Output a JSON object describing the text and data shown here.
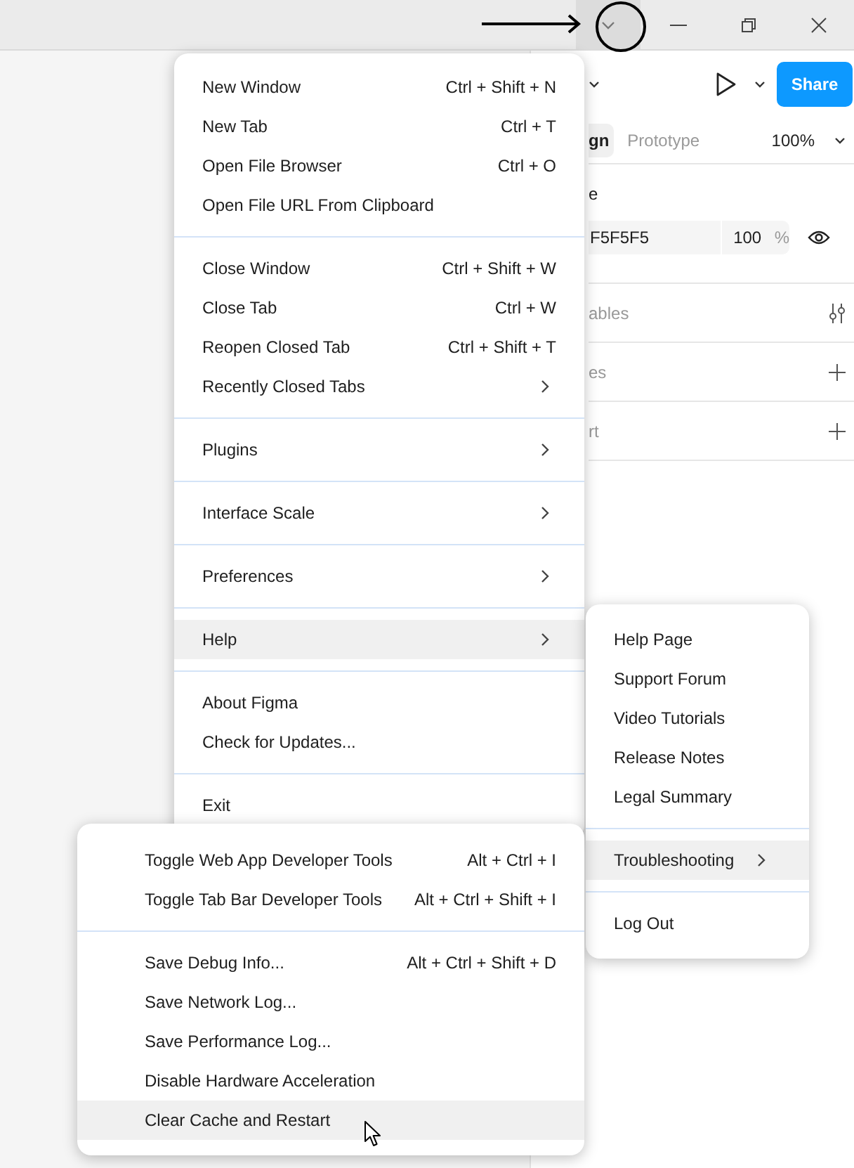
{
  "toolbar": {
    "share": "Share"
  },
  "panel": {
    "tabs": [
      {
        "label": "gn",
        "selected": true
      },
      {
        "label": "Prototype",
        "selected": false
      }
    ],
    "zoom": "100%",
    "section_label": "e",
    "fill": {
      "hex": "F5F5F5",
      "opacity": "100",
      "unit": "%"
    },
    "sections": [
      {
        "label": "ables",
        "kind": "settings"
      },
      {
        "label": "es",
        "kind": "add"
      },
      {
        "label": "rt",
        "kind": "add"
      }
    ]
  },
  "main_menu": {
    "groups": [
      {
        "items": [
          {
            "label": "New Window",
            "shortcut": "Ctrl + Shift + N",
            "submenu": false,
            "selected": false
          },
          {
            "label": "New Tab",
            "shortcut": "Ctrl + T",
            "submenu": false,
            "selected": false
          },
          {
            "label": "Open File Browser",
            "shortcut": "Ctrl + O",
            "submenu": false,
            "selected": false
          },
          {
            "label": "Open File URL From Clipboard",
            "submenu": false,
            "selected": false
          }
        ]
      },
      {
        "items": [
          {
            "label": "Close Window",
            "shortcut": "Ctrl + Shift + W",
            "submenu": false,
            "selected": false
          },
          {
            "label": "Close Tab",
            "shortcut": "Ctrl + W",
            "submenu": false,
            "selected": false
          },
          {
            "label": "Reopen Closed Tab",
            "shortcut": "Ctrl + Shift + T",
            "submenu": false,
            "selected": false
          },
          {
            "label": "Recently Closed Tabs",
            "submenu": true,
            "selected": false
          }
        ]
      },
      {
        "items": [
          {
            "label": "Plugins",
            "submenu": true,
            "selected": false
          }
        ]
      },
      {
        "items": [
          {
            "label": "Interface Scale",
            "submenu": true,
            "selected": false
          }
        ]
      },
      {
        "items": [
          {
            "label": "Preferences",
            "submenu": true,
            "selected": false
          }
        ]
      },
      {
        "items": [
          {
            "label": "Help",
            "submenu": true,
            "selected": true
          }
        ]
      },
      {
        "items": [
          {
            "label": "About Figma",
            "submenu": false,
            "selected": false
          },
          {
            "label": "Check for Updates...",
            "submenu": false,
            "selected": false
          }
        ]
      },
      {
        "items": [
          {
            "label": "Exit",
            "submenu": false,
            "selected": false
          }
        ]
      }
    ]
  },
  "help_menu": {
    "groups": [
      {
        "items": [
          {
            "label": "Help Page",
            "submenu": false,
            "selected": false
          },
          {
            "label": "Support Forum",
            "submenu": false,
            "selected": false
          },
          {
            "label": "Video Tutorials",
            "submenu": false,
            "selected": false
          },
          {
            "label": "Release Notes",
            "submenu": false,
            "selected": false
          },
          {
            "label": "Legal Summary",
            "submenu": false,
            "selected": false
          }
        ]
      },
      {
        "items": [
          {
            "label": "Troubleshooting",
            "submenu": true,
            "selected": true
          }
        ]
      },
      {
        "items": [
          {
            "label": "Log Out",
            "submenu": false,
            "selected": false
          }
        ]
      }
    ]
  },
  "troubleshooting_menu": {
    "groups": [
      {
        "items": [
          {
            "label": "Toggle Web App Developer Tools",
            "shortcut": "Alt + Ctrl + I",
            "submenu": false,
            "selected": false
          },
          {
            "label": "Toggle Tab Bar Developer Tools",
            "shortcut": "Alt + Ctrl + Shift + I",
            "submenu": false,
            "selected": false
          }
        ]
      },
      {
        "items": [
          {
            "label": "Save Debug Info...",
            "shortcut": "Alt + Ctrl + Shift + D",
            "submenu": false,
            "selected": false
          },
          {
            "label": "Save Network Log...",
            "submenu": false,
            "selected": false
          },
          {
            "label": "Save Performance Log...",
            "submenu": false,
            "selected": false
          },
          {
            "label": "Disable Hardware Acceleration",
            "submenu": false,
            "selected": false
          },
          {
            "label": "Clear Cache and Restart",
            "submenu": false,
            "selected": true
          }
        ]
      }
    ]
  }
}
